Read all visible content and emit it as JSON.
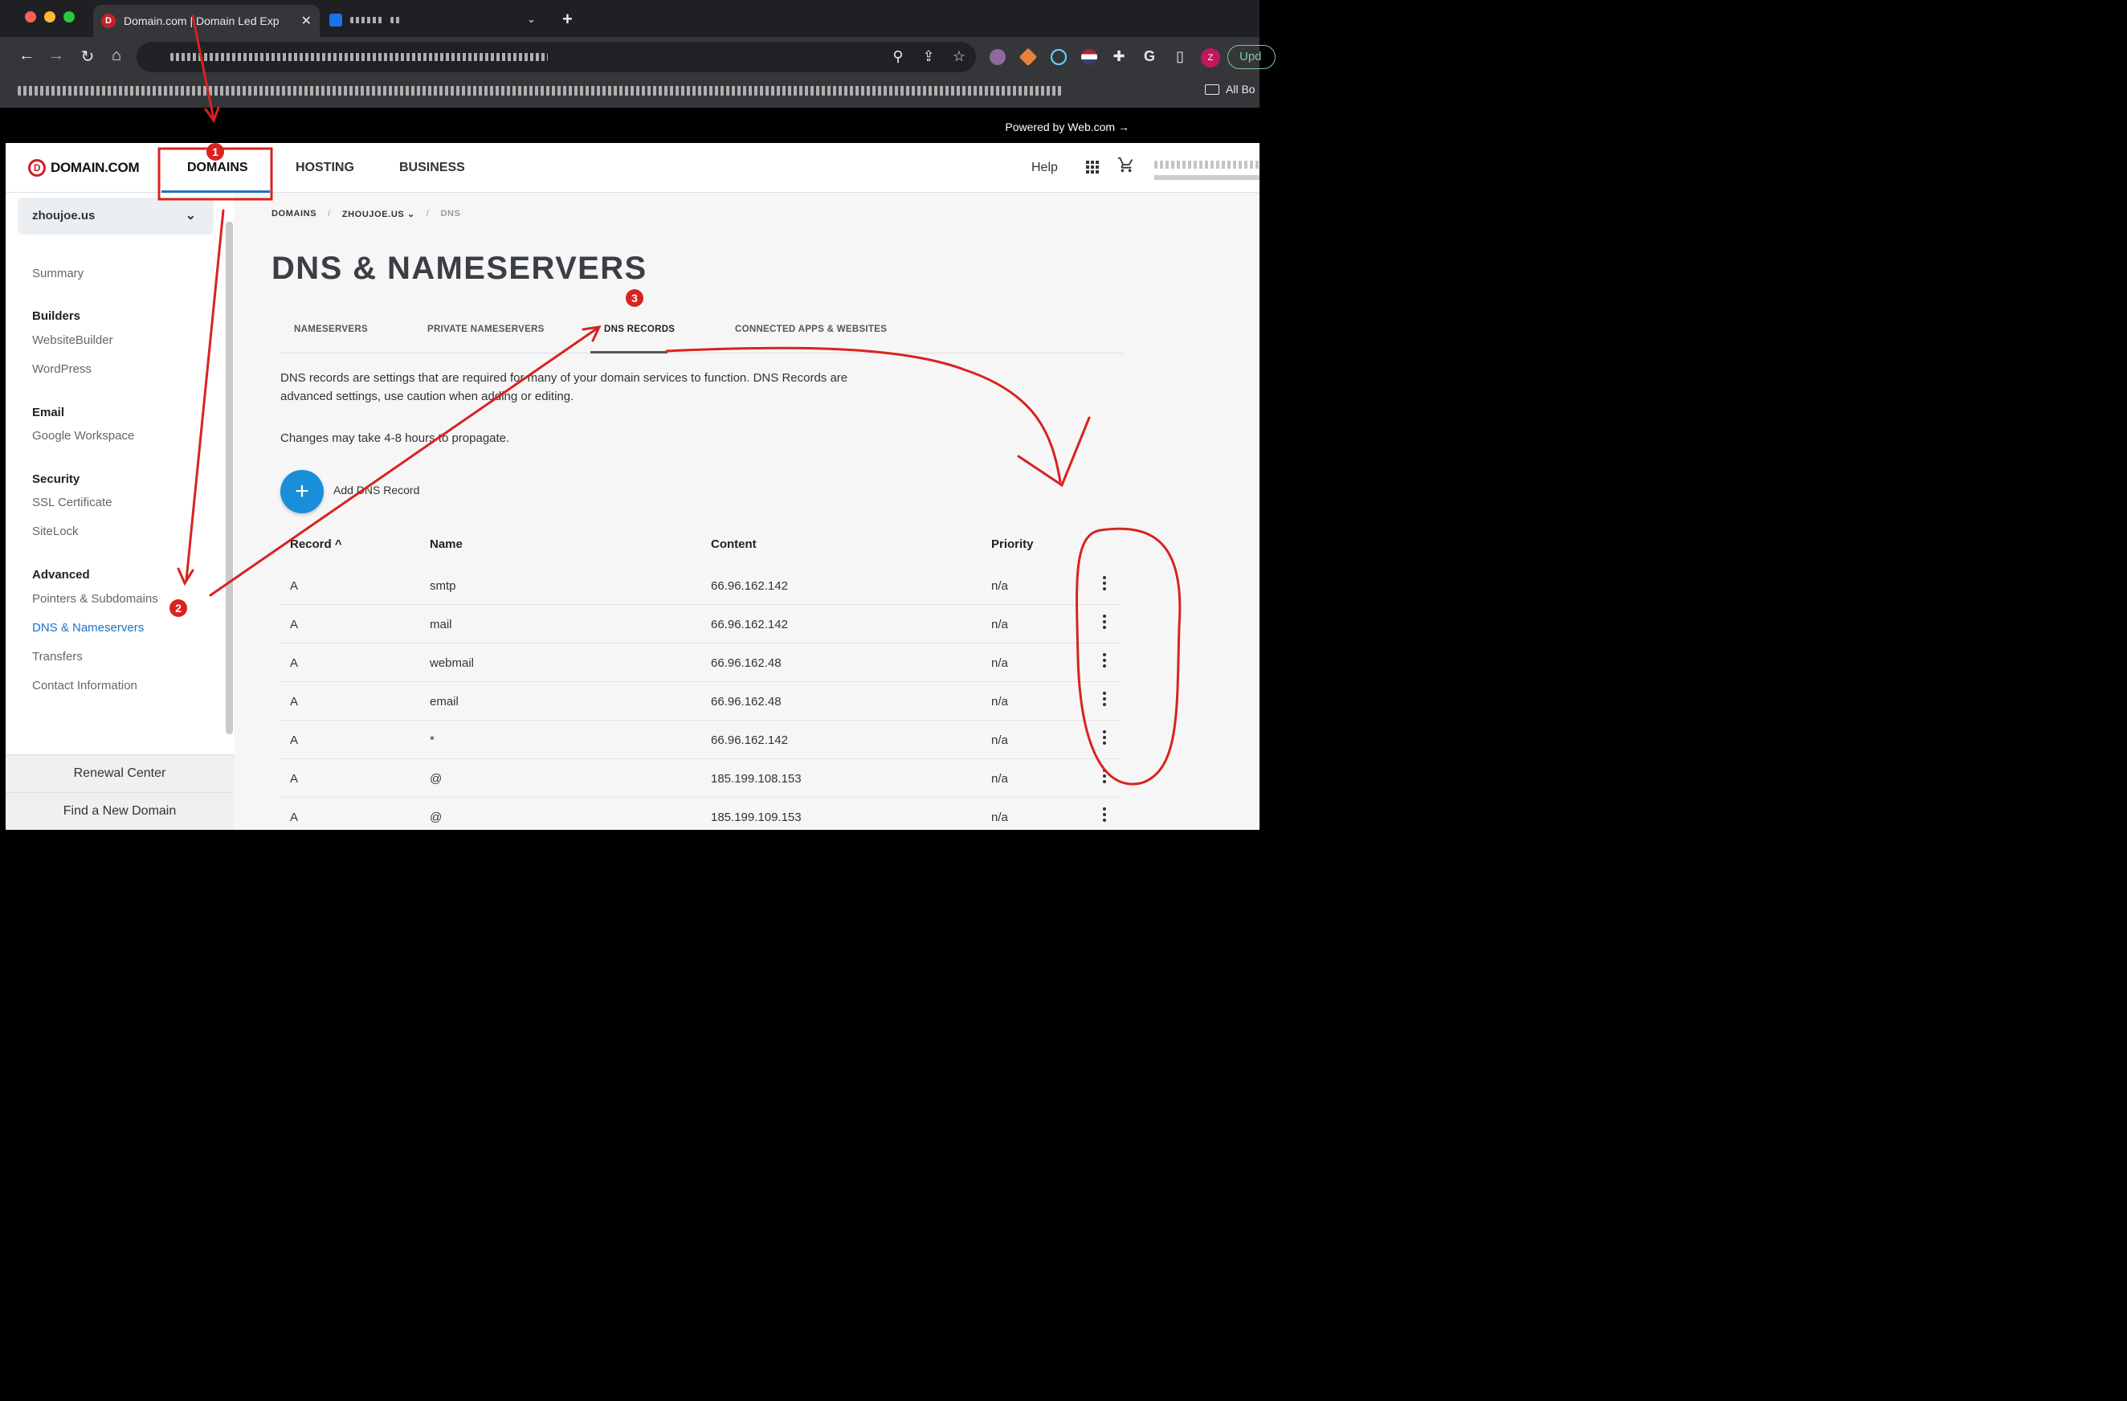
{
  "browser": {
    "active_tab_title": "Domain.com | Domain Led Exp",
    "tab_close": "✕",
    "new_tab": "+",
    "tab_search": "⌄",
    "profile_letter": "Z",
    "update_label": "Upd",
    "bookmarks_all": "All Bo",
    "nav_back": "←",
    "nav_forward": "→",
    "nav_reload": "↻",
    "nav_home": "⌂",
    "zoom": "⚲",
    "share": "⇪",
    "star": "☆",
    "extensions": "✚",
    "sidepanel": "▯",
    "grammarly": "G"
  },
  "site": {
    "powered_by": "Powered by Web.com →",
    "logo_mark": "D",
    "logo_text": "DOMAIN.COM",
    "nav": {
      "domains": "DOMAINS",
      "hosting": "HOSTING",
      "business": "BUSINESS",
      "help": "Help"
    },
    "cart_icon": "🛒"
  },
  "sidebar": {
    "domain": "zhoujoe.us",
    "chevron": "⌄",
    "summary": "Summary",
    "sections": [
      {
        "heading": "Builders",
        "items": [
          "WebsiteBuilder",
          "WordPress"
        ]
      },
      {
        "heading": "Email",
        "items": [
          "Google Workspace"
        ]
      },
      {
        "heading": "Security",
        "items": [
          "SSL Certificate",
          "SiteLock"
        ]
      },
      {
        "heading": "Advanced",
        "items": [
          "Pointers & Subdomains",
          "DNS & Nameservers",
          "Transfers",
          "Contact Information"
        ]
      }
    ],
    "renewal_center": "Renewal Center",
    "find_new_domain": "Find a New Domain"
  },
  "main": {
    "breadcrumb": [
      "DOMAINS",
      "ZHOUJOE.US ⌄",
      "DNS"
    ],
    "breadcrumb_sep": "/",
    "title": "DNS & NAMESERVERS",
    "tabs": [
      "NAMESERVERS",
      "PRIVATE NAMESERVERS",
      "DNS RECORDS",
      "CONNECTED APPS & WEBSITES"
    ],
    "active_tab": "DNS RECORDS",
    "description": "DNS records are settings that are required for many of your domain services to function. DNS Records are advanced settings, use caution when adding or editing.",
    "propagation_note": "Changes may take 4-8 hours to propagate.",
    "add_icon": "+",
    "add_label": "Add DNS Record",
    "table": {
      "headers": {
        "record": "Record ^",
        "name": "Name",
        "content": "Content",
        "priority": "Priority"
      },
      "rows": [
        {
          "record": "A",
          "name": "smtp",
          "content": "66.96.162.142",
          "priority": "n/a"
        },
        {
          "record": "A",
          "name": "mail",
          "content": "66.96.162.142",
          "priority": "n/a"
        },
        {
          "record": "A",
          "name": "webmail",
          "content": "66.96.162.48",
          "priority": "n/a"
        },
        {
          "record": "A",
          "name": "email",
          "content": "66.96.162.48",
          "priority": "n/a"
        },
        {
          "record": "A",
          "name": "*",
          "content": "66.96.162.142",
          "priority": "n/a"
        },
        {
          "record": "A",
          "name": "@",
          "content": "185.199.108.153",
          "priority": "n/a"
        },
        {
          "record": "A",
          "name": "@",
          "content": "185.199.109.153",
          "priority": "n/a"
        }
      ]
    }
  },
  "annotations": {
    "step1": "1",
    "step2": "2",
    "step3": "3",
    "color": "#d8231f"
  }
}
